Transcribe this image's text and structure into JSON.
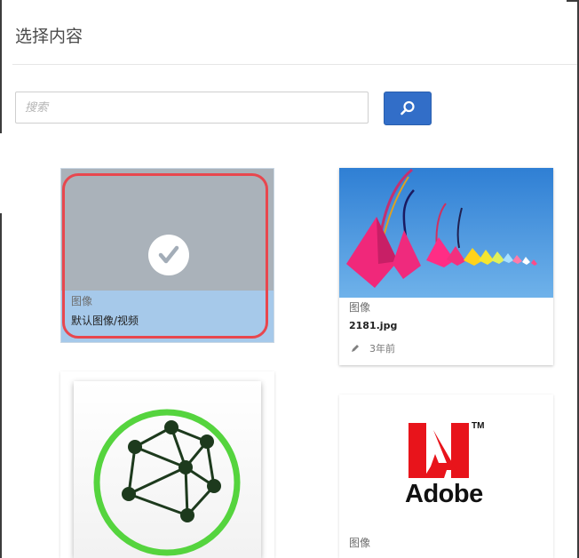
{
  "dialog": {
    "title": "选择内容"
  },
  "search": {
    "placeholder": "搜索",
    "value": ""
  },
  "colors": {
    "accent": "#326ec8",
    "selection_ring": "#e8474e",
    "selected_card_bg": "#a6c9ea"
  },
  "cards": [
    {
      "type": "图像",
      "name": "默认图像/视频",
      "selected": true,
      "icon": "check-icon"
    },
    {
      "type": "图像",
      "name": "2181.jpg",
      "modified": "3年前",
      "icon": "pencil-icon"
    },
    {
      "type": "",
      "name": ""
    },
    {
      "type": "图像",
      "name": "",
      "logo_text": "Adobe",
      "logo_mark": "TM"
    }
  ]
}
